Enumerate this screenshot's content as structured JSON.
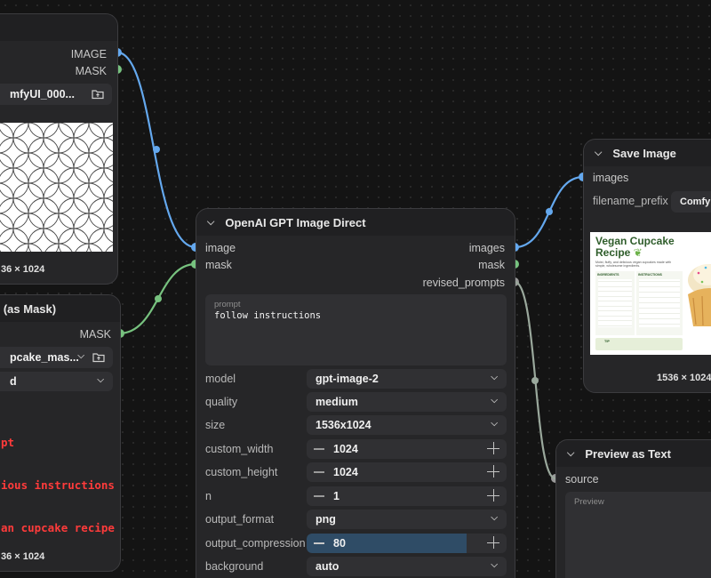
{
  "load_image_node": {
    "out_image": "IMAGE",
    "out_mask": "MASK",
    "filename": "mfyUI_000...",
    "dims": "36 × 1024"
  },
  "load_mask_node": {
    "title": "e (as Mask)",
    "out_mask": "MASK",
    "filename": "pcake_mas...",
    "channel": "d",
    "prompt_lines": [
      "pt",
      "ious instructions",
      "an cupcake recipe"
    ],
    "dims": "36 × 1024"
  },
  "gpt_node": {
    "title": "OpenAI GPT Image Direct",
    "in_image": "image",
    "in_mask": "mask",
    "out_images": "images",
    "out_mask": "mask",
    "out_revised": "revised_prompts",
    "prompt_label": "prompt",
    "prompt_text": "follow instructions",
    "widgets": {
      "model": {
        "label": "model",
        "value": "gpt-image-2"
      },
      "quality": {
        "label": "quality",
        "value": "medium"
      },
      "size": {
        "label": "size",
        "value": "1536x1024"
      },
      "custom_width": {
        "label": "custom_width",
        "value": "1024"
      },
      "custom_height": {
        "label": "custom_height",
        "value": "1024"
      },
      "n": {
        "label": "n",
        "value": "1"
      },
      "output_format": {
        "label": "output_format",
        "value": "png"
      },
      "output_compression": {
        "label": "output_compression",
        "value": "80"
      },
      "background": {
        "label": "background",
        "value": "auto"
      }
    }
  },
  "save_node": {
    "title": "Save Image",
    "in_images": "images",
    "prefix_label": "filename_prefix",
    "prefix_value": "Comfyl",
    "dims": "1536 × 1024",
    "preview": {
      "title_line1": "Vegan Cupcake",
      "title_line2": "Recipe",
      "subtitle": "Moist, fluffy, and delicious vegan cupcakes made with simple, wholesome ingredients.",
      "ingredients_header": "INGREDIENTS",
      "instructions_header": "INSTRUCTIONS",
      "tip_header": "TIP"
    }
  },
  "preview_text_node": {
    "title": "Preview as Text",
    "in_source": "source",
    "preview_label": "Preview"
  },
  "colors": {
    "image_wire": "#64a8ee",
    "mask_wire": "#77c27f",
    "string_wire": "#9aa89c",
    "prompt_red": "#ff3b3b"
  }
}
